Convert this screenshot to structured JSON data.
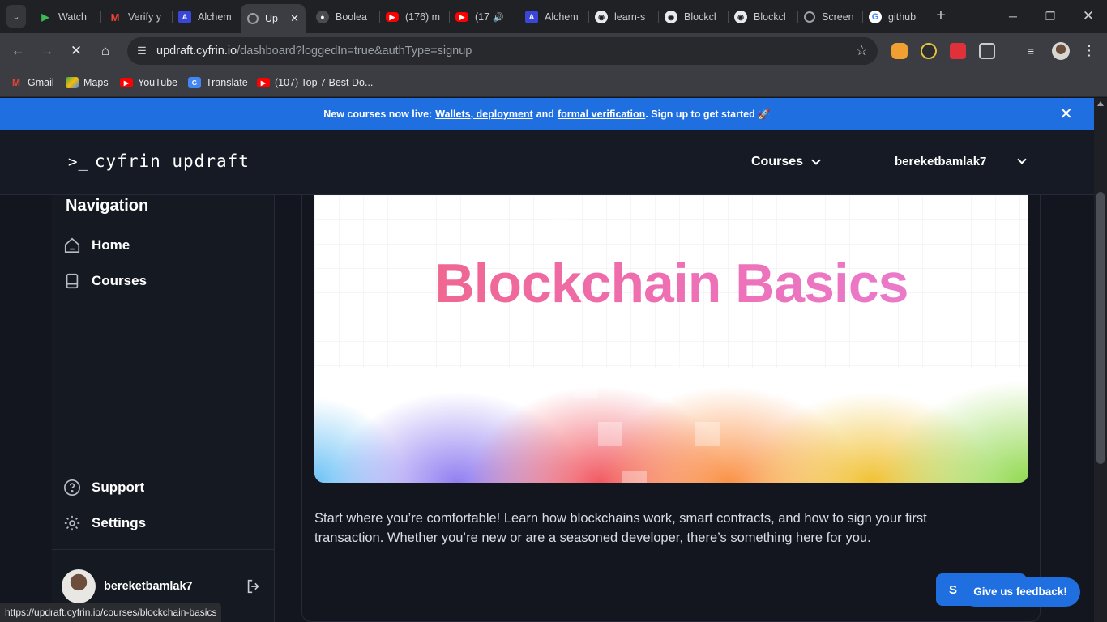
{
  "browser": {
    "tabs": [
      {
        "title": "Watch",
        "favicon": "play-icon",
        "color": "#3cba54"
      },
      {
        "title": "Verify y",
        "favicon": "gmail-icon",
        "color": "#ea4335"
      },
      {
        "title": "Alchem",
        "favicon": "alchemy-icon",
        "color": "#3a46d8"
      },
      {
        "title": "Up",
        "favicon": "updraft-icon",
        "color": "#9aa0a6",
        "active": true
      },
      {
        "title": "Boolea",
        "favicon": "bot-icon",
        "color": "#2b2d30"
      },
      {
        "title": "(176) m",
        "favicon": "youtube-icon",
        "color": "#ff0000"
      },
      {
        "title": "(17",
        "favicon": "youtube-icon",
        "color": "#ff0000"
      },
      {
        "title": "Alchem",
        "favicon": "alchemy-icon",
        "color": "#3a46d8"
      },
      {
        "title": "learn-s",
        "favicon": "github-icon",
        "color": "#e8eaed"
      },
      {
        "title": "Blockcl",
        "favicon": "github-icon",
        "color": "#e8eaed"
      },
      {
        "title": "Blockcl",
        "favicon": "github-icon",
        "color": "#e8eaed"
      },
      {
        "title": "Screen",
        "favicon": "globe-icon",
        "color": "#9aa0a6"
      },
      {
        "title": "github",
        "favicon": "google-icon",
        "color": "#4285f4"
      }
    ],
    "address": {
      "host": "updraft.cyfrin.io",
      "path": "/dashboard?loggedIn=true&authType=signup"
    },
    "bookmarks": [
      {
        "label": "Gmail",
        "icon": "gmail-icon",
        "color": "#ea4335"
      },
      {
        "label": "Maps",
        "icon": "maps-icon",
        "color": "#34a853"
      },
      {
        "label": "YouTube",
        "icon": "youtube-icon",
        "color": "#ff0000"
      },
      {
        "label": "Translate",
        "icon": "translate-icon",
        "color": "#4285f4"
      },
      {
        "label": "(107) Top 7 Best Do...",
        "icon": "youtube-icon",
        "color": "#ff0000"
      }
    ],
    "status_url": "https://updraft.cyfrin.io/courses/blockchain-basics"
  },
  "banner": {
    "prefix": "New courses now live:",
    "link1": "Wallets, deployment",
    "mid": "and",
    "link2": "formal verification",
    "suffix": ". Sign up to get started 🚀"
  },
  "header": {
    "logo_prompt": ">_",
    "logo_text": "cyfrin updraft",
    "courses_label": "Courses",
    "username": "bereketbamlak7"
  },
  "sidebar": {
    "title": "Navigation",
    "items": [
      {
        "label": "Home",
        "icon": "home-icon"
      },
      {
        "label": "Courses",
        "icon": "book-icon"
      },
      {
        "label": "Support",
        "icon": "help-circle-icon"
      },
      {
        "label": "Settings",
        "icon": "gear-icon"
      }
    ],
    "profile_name": "bereketbamlak7"
  },
  "course": {
    "hero_title": "Blockchain Basics",
    "description": "Start where you’re comfortable! Learn how blockchains work, smart contracts, and how to sign your first transaction. Whether you’re new or are a seasoned developer, there’s something here for you.",
    "button_partial": "S"
  },
  "feedback_label": "Give us feedback!"
}
